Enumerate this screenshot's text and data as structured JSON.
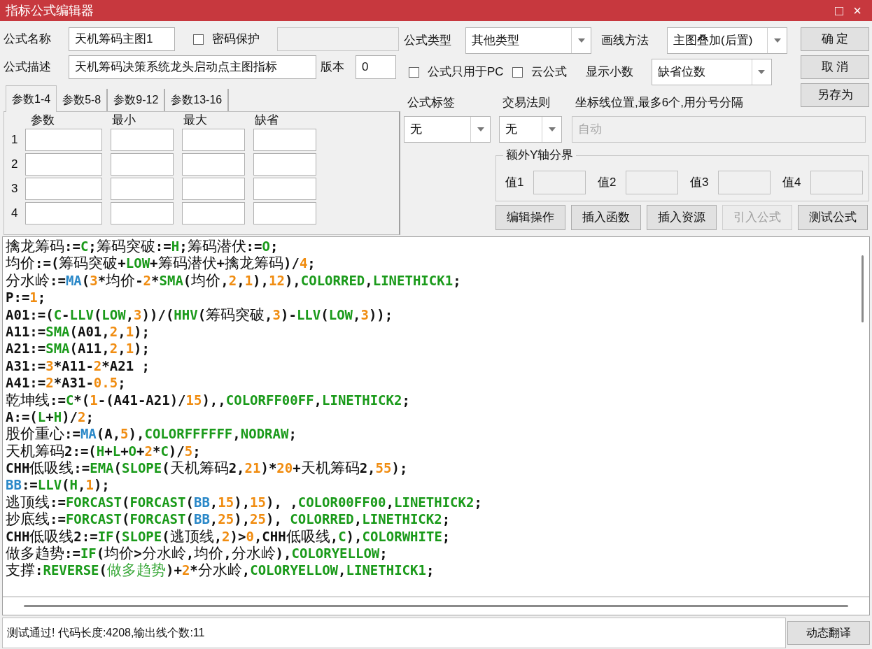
{
  "window": {
    "title": "指标公式编辑器",
    "controls": [
      "□",
      "×"
    ]
  },
  "formula_name": {
    "label": "公式名称",
    "value": "天机筹码主图1"
  },
  "password": {
    "label": "密码保护",
    "checked": false
  },
  "description": {
    "label": "公式描述",
    "value": "天机筹码决策系统龙头启动点主图指标"
  },
  "version": {
    "label": "版本",
    "value": "0"
  },
  "param_tabs": [
    {
      "label": "参数1-4",
      "selected": true
    },
    {
      "label": "参数5-8",
      "selected": false
    },
    {
      "label": "参数9-12",
      "selected": false
    },
    {
      "label": "参数13-16",
      "selected": false
    }
  ],
  "param_columns": [
    "参数",
    "最小",
    "最大",
    "缺省"
  ],
  "param_rows": [
    "1",
    "2",
    "3",
    "4"
  ],
  "formula_type": {
    "label": "公式类型",
    "value": "其他类型"
  },
  "draw_method": {
    "label": "画线方法",
    "value": "主图叠加(后置)"
  },
  "pc_only": {
    "label": "公式只用于PC",
    "checked": false
  },
  "cloud": {
    "label": "云公式",
    "checked": false
  },
  "decimals": {
    "label": "显示小数",
    "value": "缺省位数"
  },
  "side_buttons": [
    {
      "label": "确 定"
    },
    {
      "label": "取 消"
    },
    {
      "label": "另存为"
    }
  ],
  "formula_tag": {
    "label": "公式标签",
    "value": "无"
  },
  "trade_rule": {
    "label": "交易法则",
    "value": "无"
  },
  "axis_lines": {
    "label": "坐标线位置,最多6个,用分号分隔",
    "placeholder": "自动"
  },
  "y_bounds": {
    "title": "额外Y轴分界",
    "fields": [
      "值1",
      "值2",
      "值3",
      "值4"
    ]
  },
  "action_buttons": [
    {
      "label": "编辑操作",
      "disabled": false
    },
    {
      "label": "插入函数",
      "disabled": false
    },
    {
      "label": "插入资源",
      "disabled": false
    },
    {
      "label": "引入公式",
      "disabled": true
    },
    {
      "label": "测试公式",
      "disabled": false
    }
  ],
  "code_lines": [
    [
      {
        "kind": "plain",
        "text": "擒龙筹码:="
      },
      {
        "kind": "keyword",
        "text": "C"
      },
      {
        "kind": "plain",
        "text": ";筹码突破:="
      },
      {
        "kind": "keyword",
        "text": "H"
      },
      {
        "kind": "plain",
        "text": ";筹码潜伏:="
      },
      {
        "kind": "keyword",
        "text": "O"
      },
      {
        "kind": "plain",
        "text": ";"
      }
    ],
    [
      {
        "kind": "plain",
        "text": "均价:=(筹码突破+"
      },
      {
        "kind": "keyword",
        "text": "LOW"
      },
      {
        "kind": "plain",
        "text": "+筹码潜伏+擒龙筹码)/"
      },
      {
        "kind": "number",
        "text": "4"
      },
      {
        "kind": "plain",
        "text": ";"
      }
    ],
    [
      {
        "kind": "plain",
        "text": "分水岭:="
      },
      {
        "kind": "builtin",
        "text": "MA"
      },
      {
        "kind": "plain",
        "text": "("
      },
      {
        "kind": "number",
        "text": "3"
      },
      {
        "kind": "plain",
        "text": "*均价-"
      },
      {
        "kind": "number",
        "text": "2"
      },
      {
        "kind": "plain",
        "text": "*"
      },
      {
        "kind": "keyword",
        "text": "SMA"
      },
      {
        "kind": "plain",
        "text": "(均价,"
      },
      {
        "kind": "number",
        "text": "2"
      },
      {
        "kind": "plain",
        "text": ","
      },
      {
        "kind": "number",
        "text": "1"
      },
      {
        "kind": "plain",
        "text": "),"
      },
      {
        "kind": "number",
        "text": "12"
      },
      {
        "kind": "plain",
        "text": "),"
      },
      {
        "kind": "keyword",
        "text": "COLORRED"
      },
      {
        "kind": "plain",
        "text": ","
      },
      {
        "kind": "keyword",
        "text": "LINETHICK1"
      },
      {
        "kind": "plain",
        "text": ";"
      }
    ],
    [
      {
        "kind": "plain",
        "text": "P:="
      },
      {
        "kind": "number",
        "text": "1"
      },
      {
        "kind": "plain",
        "text": ";"
      }
    ],
    [
      {
        "kind": "plain",
        "text": "A01:=("
      },
      {
        "kind": "keyword",
        "text": "C"
      },
      {
        "kind": "plain",
        "text": "-"
      },
      {
        "kind": "keyword",
        "text": "LLV"
      },
      {
        "kind": "plain",
        "text": "("
      },
      {
        "kind": "keyword",
        "text": "LOW"
      },
      {
        "kind": "plain",
        "text": ","
      },
      {
        "kind": "number",
        "text": "3"
      },
      {
        "kind": "plain",
        "text": "))/("
      },
      {
        "kind": "keyword",
        "text": "HHV"
      },
      {
        "kind": "plain",
        "text": "(筹码突破,"
      },
      {
        "kind": "number",
        "text": "3"
      },
      {
        "kind": "plain",
        "text": ")-"
      },
      {
        "kind": "keyword",
        "text": "LLV"
      },
      {
        "kind": "plain",
        "text": "("
      },
      {
        "kind": "keyword",
        "text": "LOW"
      },
      {
        "kind": "plain",
        "text": ","
      },
      {
        "kind": "number",
        "text": "3"
      },
      {
        "kind": "plain",
        "text": "));"
      }
    ],
    [
      {
        "kind": "plain",
        "text": "A11:="
      },
      {
        "kind": "keyword",
        "text": "SMA"
      },
      {
        "kind": "plain",
        "text": "(A01,"
      },
      {
        "kind": "number",
        "text": "2"
      },
      {
        "kind": "plain",
        "text": ","
      },
      {
        "kind": "number",
        "text": "1"
      },
      {
        "kind": "plain",
        "text": ");"
      }
    ],
    [
      {
        "kind": "plain",
        "text": "A21:="
      },
      {
        "kind": "keyword",
        "text": "SMA"
      },
      {
        "kind": "plain",
        "text": "(A11,"
      },
      {
        "kind": "number",
        "text": "2"
      },
      {
        "kind": "plain",
        "text": ","
      },
      {
        "kind": "number",
        "text": "1"
      },
      {
        "kind": "plain",
        "text": ");"
      }
    ],
    [
      {
        "kind": "plain",
        "text": "A31:="
      },
      {
        "kind": "number",
        "text": "3"
      },
      {
        "kind": "plain",
        "text": "*A11-"
      },
      {
        "kind": "number",
        "text": "2"
      },
      {
        "kind": "plain",
        "text": "*A21 ;"
      }
    ],
    [
      {
        "kind": "plain",
        "text": "A41:="
      },
      {
        "kind": "number",
        "text": "2"
      },
      {
        "kind": "plain",
        "text": "*A31-"
      },
      {
        "kind": "number",
        "text": "0.5"
      },
      {
        "kind": "plain",
        "text": ";"
      }
    ],
    [
      {
        "kind": "plain",
        "text": "乾坤线:="
      },
      {
        "kind": "keyword",
        "text": "C"
      },
      {
        "kind": "plain",
        "text": "*("
      },
      {
        "kind": "number",
        "text": "1"
      },
      {
        "kind": "plain",
        "text": "-(A41-A21)/"
      },
      {
        "kind": "number",
        "text": "15"
      },
      {
        "kind": "plain",
        "text": "),,"
      },
      {
        "kind": "keyword",
        "text": "COLORFF00FF"
      },
      {
        "kind": "plain",
        "text": ","
      },
      {
        "kind": "keyword",
        "text": "LINETHICK2"
      },
      {
        "kind": "plain",
        "text": ";"
      }
    ],
    [
      {
        "kind": "plain",
        "text": "A:=("
      },
      {
        "kind": "keyword",
        "text": "L"
      },
      {
        "kind": "plain",
        "text": "+"
      },
      {
        "kind": "keyword",
        "text": "H"
      },
      {
        "kind": "plain",
        "text": ")/"
      },
      {
        "kind": "number",
        "text": "2"
      },
      {
        "kind": "plain",
        "text": ";"
      }
    ],
    [
      {
        "kind": "plain",
        "text": "股价重心:="
      },
      {
        "kind": "builtin",
        "text": "MA"
      },
      {
        "kind": "plain",
        "text": "(A,"
      },
      {
        "kind": "number",
        "text": "5"
      },
      {
        "kind": "plain",
        "text": "),"
      },
      {
        "kind": "keyword",
        "text": "COLORFFFFFF"
      },
      {
        "kind": "plain",
        "text": ","
      },
      {
        "kind": "keyword",
        "text": "NODRAW"
      },
      {
        "kind": "plain",
        "text": ";"
      }
    ],
    [
      {
        "kind": "plain",
        "text": "天机筹码2:=("
      },
      {
        "kind": "keyword",
        "text": "H"
      },
      {
        "kind": "plain",
        "text": "+"
      },
      {
        "kind": "keyword",
        "text": "L"
      },
      {
        "kind": "plain",
        "text": "+"
      },
      {
        "kind": "keyword",
        "text": "O"
      },
      {
        "kind": "plain",
        "text": "+"
      },
      {
        "kind": "number",
        "text": "2"
      },
      {
        "kind": "plain",
        "text": "*"
      },
      {
        "kind": "keyword",
        "text": "C"
      },
      {
        "kind": "plain",
        "text": ")/"
      },
      {
        "kind": "number",
        "text": "5"
      },
      {
        "kind": "plain",
        "text": ";"
      }
    ],
    [
      {
        "kind": "plain",
        "text": "CHH低吸线:="
      },
      {
        "kind": "keyword",
        "text": "EMA"
      },
      {
        "kind": "plain",
        "text": "("
      },
      {
        "kind": "keyword",
        "text": "SLOPE"
      },
      {
        "kind": "plain",
        "text": "(天机筹码2,"
      },
      {
        "kind": "number",
        "text": "21"
      },
      {
        "kind": "plain",
        "text": ")*"
      },
      {
        "kind": "number",
        "text": "20"
      },
      {
        "kind": "plain",
        "text": "+天机筹码2,"
      },
      {
        "kind": "number",
        "text": "55"
      },
      {
        "kind": "plain",
        "text": ");"
      }
    ],
    [
      {
        "kind": "builtin",
        "text": "BB"
      },
      {
        "kind": "plain",
        "text": ":="
      },
      {
        "kind": "keyword",
        "text": "LLV"
      },
      {
        "kind": "plain",
        "text": "("
      },
      {
        "kind": "keyword",
        "text": "H"
      },
      {
        "kind": "plain",
        "text": ","
      },
      {
        "kind": "number",
        "text": "1"
      },
      {
        "kind": "plain",
        "text": ");"
      }
    ],
    [
      {
        "kind": "plain",
        "text": "逃顶线:="
      },
      {
        "kind": "keyword",
        "text": "FORCAST"
      },
      {
        "kind": "plain",
        "text": "("
      },
      {
        "kind": "keyword",
        "text": "FORCAST"
      },
      {
        "kind": "plain",
        "text": "("
      },
      {
        "kind": "builtin",
        "text": "BB"
      },
      {
        "kind": "plain",
        "text": ","
      },
      {
        "kind": "number",
        "text": "15"
      },
      {
        "kind": "plain",
        "text": "),"
      },
      {
        "kind": "number",
        "text": "15"
      },
      {
        "kind": "plain",
        "text": "), ,"
      },
      {
        "kind": "keyword",
        "text": "COLOR00FF00"
      },
      {
        "kind": "plain",
        "text": ","
      },
      {
        "kind": "keyword",
        "text": "LINETHICK2"
      },
      {
        "kind": "plain",
        "text": ";"
      }
    ],
    [
      {
        "kind": "plain",
        "text": "抄底线:="
      },
      {
        "kind": "keyword",
        "text": "FORCAST"
      },
      {
        "kind": "plain",
        "text": "("
      },
      {
        "kind": "keyword",
        "text": "FORCAST"
      },
      {
        "kind": "plain",
        "text": "("
      },
      {
        "kind": "builtin",
        "text": "BB"
      },
      {
        "kind": "plain",
        "text": ","
      },
      {
        "kind": "number",
        "text": "25"
      },
      {
        "kind": "plain",
        "text": "),"
      },
      {
        "kind": "number",
        "text": "25"
      },
      {
        "kind": "plain",
        "text": "), "
      },
      {
        "kind": "keyword",
        "text": "COLORRED"
      },
      {
        "kind": "plain",
        "text": ","
      },
      {
        "kind": "keyword",
        "text": "LINETHICK2"
      },
      {
        "kind": "plain",
        "text": ";"
      }
    ],
    [
      {
        "kind": "plain",
        "text": "CHH低吸线2:="
      },
      {
        "kind": "keyword",
        "text": "IF"
      },
      {
        "kind": "plain",
        "text": "("
      },
      {
        "kind": "keyword",
        "text": "SLOPE"
      },
      {
        "kind": "plain",
        "text": "(逃顶线,"
      },
      {
        "kind": "number",
        "text": "2"
      },
      {
        "kind": "plain",
        "text": ")>"
      },
      {
        "kind": "number",
        "text": "0"
      },
      {
        "kind": "plain",
        "text": ",CHH低吸线,"
      },
      {
        "kind": "keyword",
        "text": "C"
      },
      {
        "kind": "plain",
        "text": "),"
      },
      {
        "kind": "keyword",
        "text": "COLORWHITE"
      },
      {
        "kind": "plain",
        "text": ";"
      }
    ],
    [
      {
        "kind": "plain",
        "text": "做多趋势:="
      },
      {
        "kind": "keyword",
        "text": "IF"
      },
      {
        "kind": "plain",
        "text": "(均价>分水岭,均价,分水岭),"
      },
      {
        "kind": "keyword",
        "text": "COLORYELLOW"
      },
      {
        "kind": "plain",
        "text": ";"
      }
    ],
    [
      {
        "kind": "plain",
        "text": "支撑:"
      },
      {
        "kind": "keyword",
        "text": "REVERSE"
      },
      {
        "kind": "plain",
        "text": "("
      },
      {
        "kind": "variable",
        "text": "做多趋势"
      },
      {
        "kind": "plain",
        "text": ")+"
      },
      {
        "kind": "number",
        "text": "2"
      },
      {
        "kind": "plain",
        "text": "*分水岭,"
      },
      {
        "kind": "keyword",
        "text": "COLORYELLOW"
      },
      {
        "kind": "plain",
        "text": ","
      },
      {
        "kind": "keyword",
        "text": "LINETHICK1"
      },
      {
        "kind": "plain",
        "text": ";"
      }
    ]
  ],
  "status": {
    "message": "测试通过! 代码长度:4208,输出线个数:11",
    "button": "动态翻译"
  }
}
